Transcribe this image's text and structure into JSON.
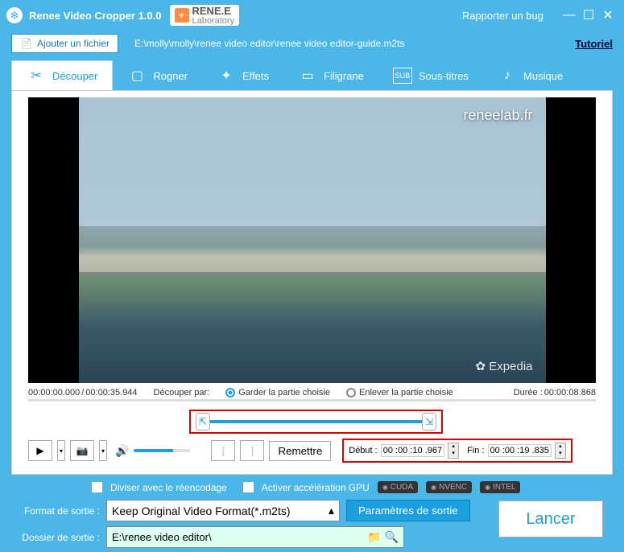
{
  "app": {
    "title": "Renee Video Cropper 1.0.0",
    "brand_top": "RENE.E",
    "brand_sub": "Laboratory",
    "bug": "Rapporter un bug"
  },
  "toolbar": {
    "add_file": "Ajouter un fichier",
    "file_path": "E:\\molly\\molly\\renee video editor\\renee video editor-guide.m2ts",
    "tutorial": "Tutoriel"
  },
  "tabs": {
    "cut": "Découper",
    "crop": "Rogner",
    "effects": "Effets",
    "watermark": "Filigrane",
    "subtitles": "Sous-titres",
    "music": "Musique"
  },
  "preview": {
    "watermark": "reneelab.fr",
    "expedia": "Expedia"
  },
  "times": {
    "start_full": "00:00:00.000",
    "end_full": "00:00:35.944",
    "cut_by": "Découper par:",
    "keep": "Garder la partie choisie",
    "remove": "Enlever la partie choisie",
    "duration_label": "Durée :",
    "duration": "00:00:08.868"
  },
  "controls": {
    "reset": "Remettre",
    "start_label": "Début :",
    "end_label": "Fin :",
    "start_val": "00 :00 :10 .967",
    "end_val": "00 :00 :19 .835"
  },
  "bottom": {
    "reencode": "Diviser avec le réencodage",
    "gpu": "Activer accélération GPU",
    "cuda": "CUDA",
    "nvenc": "NVENC",
    "intel": "INTEL",
    "format_label": "Format de sortie :",
    "format_value": "Keep Original Video Format(*.m2ts)",
    "output_params": "Paramètres de sortie",
    "folder_label": "Dossier de sortie :",
    "folder_value": "E:\\renee video editor\\",
    "launch": "Lancer"
  }
}
